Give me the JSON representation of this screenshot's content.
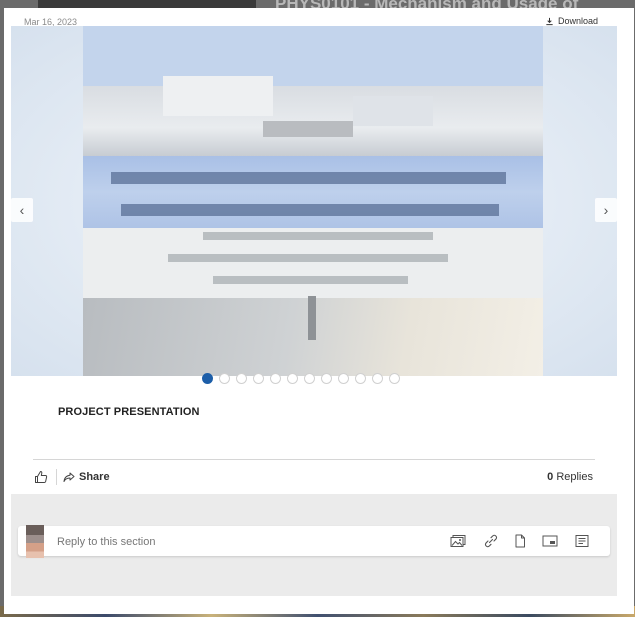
{
  "background": {
    "title": "PHYS0101 - Mechanism and Usage of"
  },
  "post": {
    "date": "Mar 16, 2023",
    "download_label": "Download",
    "section_title": "PROJECT PRESENTATION"
  },
  "carousel": {
    "slide_count": 12,
    "active_index": 0,
    "prev_icon": "chevron-left-icon",
    "next_icon": "chevron-right-icon"
  },
  "actions": {
    "like_icon": "thumbs-up-icon",
    "share_label": "Share",
    "replies_count": "0",
    "replies_label": "Replies"
  },
  "reply": {
    "placeholder": "Reply to this section",
    "tools": [
      "image-icon",
      "link-icon",
      "file-icon",
      "embed-icon",
      "form-icon"
    ]
  },
  "colors": {
    "accent": "#1d5ea8",
    "modal_bg": "#ffffff",
    "reply_area_bg": "#ebebeb"
  }
}
